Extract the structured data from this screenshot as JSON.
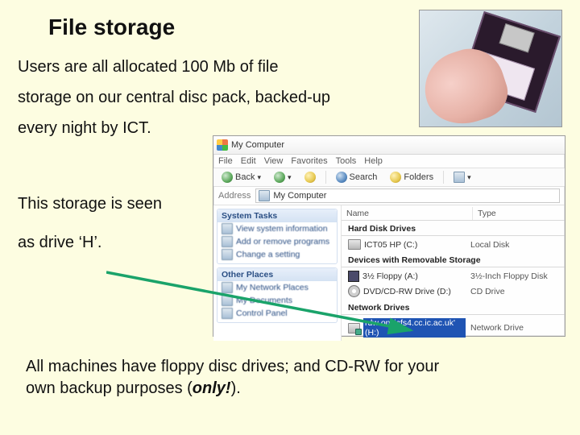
{
  "title": "File storage",
  "para1_a": "Users are all allocated 100 Mb of file",
  "para1_b": "storage on our central disc pack, backed-up",
  "para1_c": "every night by ICT.",
  "para2_a": "This storage is seen",
  "para2_b": "as drive ‘H’.",
  "footer_a": "All machines have floppy disc drives; and CD-RW for your",
  "footer_b": "own backup purposes (",
  "footer_emph": "only!",
  "footer_c": ").",
  "mc": {
    "title": "My Computer",
    "menu": [
      "File",
      "Edit",
      "View",
      "Favorites",
      "Tools",
      "Help"
    ],
    "toolbar": {
      "back": "Back",
      "search": "Search",
      "folders": "Folders"
    },
    "address_label": "Address",
    "address_value": "My Computer",
    "side": {
      "system_header": "System Tasks",
      "system_items": [
        "View system information",
        "Add or remove programs",
        "Change a setting"
      ],
      "other_header": "Other Places",
      "other_items": [
        "My Network Places",
        "My Documents",
        "Control Panel"
      ]
    },
    "columns": {
      "name": "Name",
      "type": "Type"
    },
    "groups": {
      "hdd": {
        "header": "Hard Disk Drives",
        "rows": [
          {
            "name": "ICT05 HP (C:)",
            "type": "Local Disk"
          }
        ]
      },
      "removable": {
        "header": "Devices with Removable Storage",
        "rows": [
          {
            "name": "3½ Floppy (A:)",
            "type": "3½-Inch Floppy Disk"
          },
          {
            "name": "DVD/CD-RW Drive (D:)",
            "type": "CD Drive"
          }
        ]
      },
      "network": {
        "header": "Network Drives",
        "rows": [
          {
            "name": "rdw on 'icfs4.cc.ic.ac.uk' (H:)",
            "type": "Network Drive"
          }
        ]
      }
    }
  }
}
